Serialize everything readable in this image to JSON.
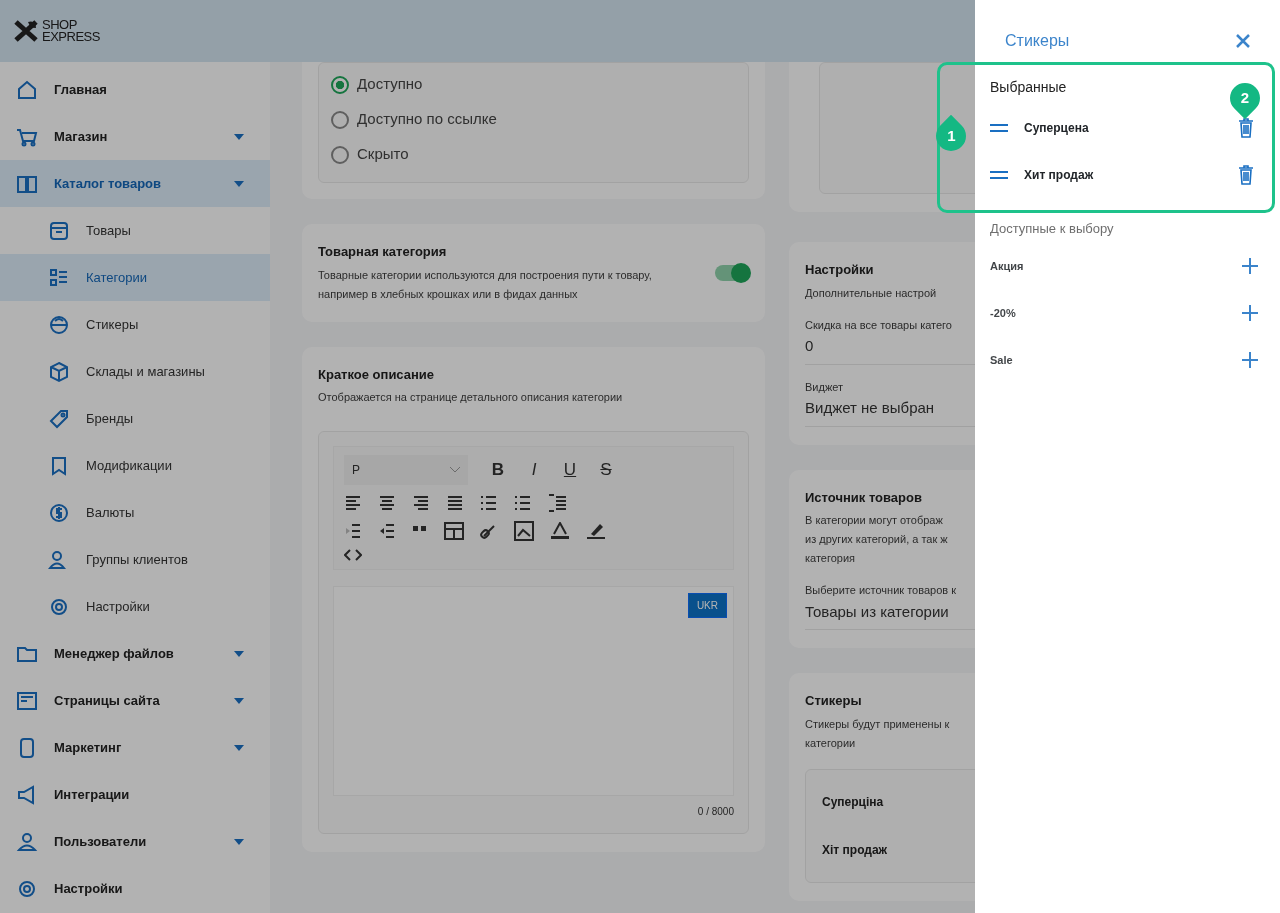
{
  "header": {
    "logo_lines": [
      "SHOP",
      "EXPRESS"
    ]
  },
  "sidebar": {
    "items": [
      {
        "label": "Главная",
        "expandable": false,
        "selected": false
      },
      {
        "label": "Магазин",
        "expandable": true,
        "selected": false
      },
      {
        "label": "Каталог товаров",
        "expandable": true,
        "selected": true,
        "children": [
          {
            "label": "Товары",
            "selected": false
          },
          {
            "label": "Категории",
            "selected": true
          },
          {
            "label": "Стикеры",
            "selected": false
          },
          {
            "label": "Склады и магазины",
            "selected": false
          },
          {
            "label": "Бренды",
            "selected": false
          },
          {
            "label": "Модификации",
            "selected": false
          },
          {
            "label": "Валюты",
            "selected": false
          },
          {
            "label": "Группы клиентов",
            "selected": false
          },
          {
            "label": "Настройки",
            "selected": false
          }
        ]
      },
      {
        "label": "Менеджер файлов",
        "expandable": true,
        "selected": false
      },
      {
        "label": "Страницы сайта",
        "expandable": true,
        "selected": false
      },
      {
        "label": "Маркетинг",
        "expandable": true,
        "selected": false
      },
      {
        "label": "Интеграции",
        "expandable": false,
        "selected": false
      },
      {
        "label": "Пользователи",
        "expandable": true,
        "selected": false
      },
      {
        "label": "Настройки",
        "expandable": false,
        "selected": false
      }
    ]
  },
  "visibility": {
    "options": [
      {
        "label": "Доступно",
        "selected": true
      },
      {
        "label": "Доступно по ссылке",
        "selected": false
      },
      {
        "label": "Скрыто",
        "selected": false
      }
    ]
  },
  "product_category": {
    "title": "Товарная категория",
    "description": "Товарные категории используются для построения пути к товару, например в хлебных крошках или в фидах данных",
    "on": true
  },
  "short_description": {
    "title": "Краткое описание",
    "description": "Отображается на странице детального описания категории",
    "editor": {
      "format": "P",
      "toolbar": [
        {
          "kind": "bold",
          "label": "B"
        },
        {
          "kind": "italic",
          "label": "I"
        },
        {
          "kind": "underline",
          "label": "U"
        },
        {
          "kind": "strike",
          "label": "S"
        }
      ],
      "language": "UKR",
      "counter": "0 / 8000"
    }
  },
  "settings": {
    "title": "Настройки",
    "description": "Дополнительные настрой",
    "fields": [
      {
        "label": "Скидка на все товары катего",
        "value": "0"
      },
      {
        "label": "Виджет",
        "value": "Виджет не выбран"
      }
    ]
  },
  "product_source": {
    "title": "Источник товаров",
    "description_lines": [
      "В категории могут отображ",
      "из других категорий, а так ж",
      "категория"
    ],
    "field": {
      "label": "Выберите источник товаров к",
      "value": "Товары из категории"
    }
  },
  "stickers_card": {
    "title": "Стикеры",
    "description_lines": [
      "Стикеры будут применены к",
      "категории"
    ],
    "rows": [
      "Суперціна",
      "Хіт продаж"
    ]
  },
  "panel": {
    "title": "Стикеры",
    "selected_heading": "Выбранные",
    "selected": [
      "Суперцена",
      "Хит продаж"
    ],
    "available_heading": "Доступные к выбору",
    "available": [
      "Акция",
      "-20%",
      "Sale"
    ]
  },
  "callouts": [
    "1",
    "2"
  ]
}
